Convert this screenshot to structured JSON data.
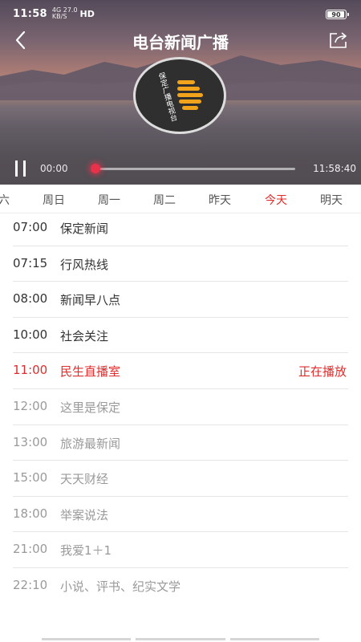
{
  "status_bar": {
    "time": "11:58",
    "network_top": "4G 27.0",
    "network_bottom": "KB/S",
    "hd": "HD",
    "battery": "90"
  },
  "header": {
    "title": "电台新闻广播",
    "back_icon": "chevron-left-icon",
    "share_icon": "share-icon"
  },
  "station_logo": {
    "text": "保定广播电视台",
    "accent": "#f0a31b"
  },
  "player": {
    "elapsed": "00:00",
    "duration": "11:58:40",
    "progress": 0,
    "accent": "#e0233a"
  },
  "days": {
    "items": [
      "六",
      "周日",
      "周一",
      "周二",
      "昨天",
      "今天",
      "明天"
    ],
    "active_index": 5,
    "active_color": "#e12a2a"
  },
  "schedule": [
    {
      "time": "07:00",
      "name": "保定新闻",
      "state": "past",
      "status": ""
    },
    {
      "time": "07:15",
      "name": "行风热线",
      "state": "past",
      "status": ""
    },
    {
      "time": "08:00",
      "name": "新闻早八点",
      "state": "past",
      "status": ""
    },
    {
      "time": "10:00",
      "name": "社会关注",
      "state": "past",
      "status": ""
    },
    {
      "time": "11:00",
      "name": "民生直播室",
      "state": "live",
      "status": "正在播放"
    },
    {
      "time": "12:00",
      "name": "这里是保定",
      "state": "future",
      "status": ""
    },
    {
      "time": "13:00",
      "name": "旅游最新闻",
      "state": "future",
      "status": ""
    },
    {
      "time": "15:00",
      "name": "天天财经",
      "state": "future",
      "status": ""
    },
    {
      "time": "18:00",
      "name": "举案说法",
      "state": "future",
      "status": ""
    },
    {
      "time": "21:00",
      "name": "我爱1＋1",
      "state": "future",
      "status": ""
    },
    {
      "time": "22:10",
      "name": "小说、评书、纪实文学",
      "state": "future",
      "status": ""
    }
  ]
}
